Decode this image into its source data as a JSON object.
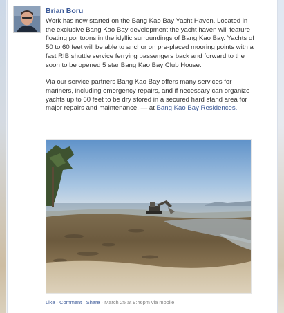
{
  "post": {
    "author": "Brian Boru",
    "paragraph1": "Work has now started on the Bang Kao Bay Yacht Haven. Located in the exclusive Bang Kao Bay development the yacht haven will feature floating pontoons in the idyllic surroundings of Bang Kao Bay. Yachts of 50 to 60 feet will be able to anchor on pre-placed mooring points with a fast RIB shuttle service ferrying passengers back and forward to the soon to be opened 5 star Bang Kao Bay Club House.",
    "paragraph2": "Via our service partners Bang Kao Bay offers many services for mariners, including emergency repairs, and if necessary can organize yachts up to 60 feet to be dry stored in a secured hard stand area for major repairs and maintenance.",
    "at_prefix": "— at",
    "location": "Bang Kao Bay Residences.",
    "photo_icon": "beach-excavator-photo"
  },
  "footer": {
    "like": "Like",
    "comment": "Comment",
    "share": "Share",
    "separator": "·",
    "timestamp": "March 25 at 9:46pm via mobile"
  },
  "colors": {
    "link": "#3b5998",
    "text": "#333333",
    "meta": "#808080"
  }
}
